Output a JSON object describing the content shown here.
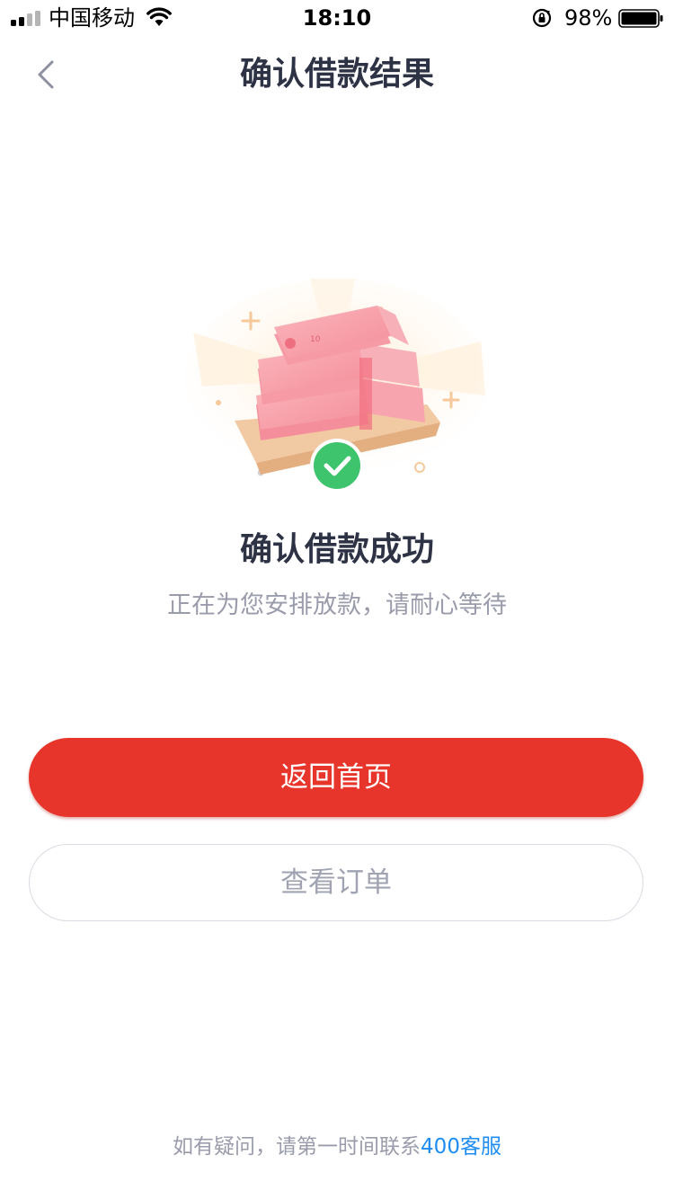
{
  "status_bar": {
    "carrier": "中国移动",
    "time": "18:10",
    "battery_percent": "98%"
  },
  "nav": {
    "title": "确认借款结果",
    "back_icon": "chevron-left-icon"
  },
  "result": {
    "title": "确认借款成功",
    "subtitle": "正在为您安排放款，请耐心等待",
    "icon": "success-check-icon"
  },
  "actions": {
    "primary_label": "返回首页",
    "secondary_label": "查看订单"
  },
  "footer": {
    "text": "如有疑问，请第一时间联系",
    "link": "400客服"
  },
  "colors": {
    "primary": "#e8352b",
    "success": "#3ec46d",
    "link": "#1f8cf2"
  }
}
